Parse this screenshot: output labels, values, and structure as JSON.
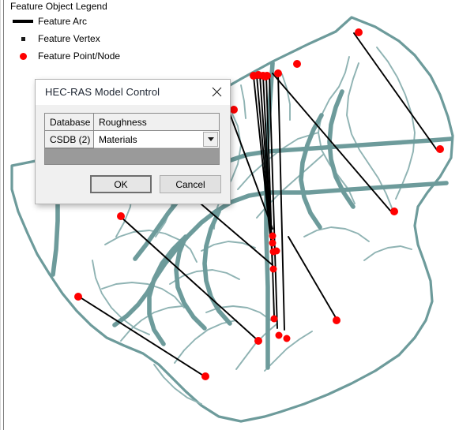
{
  "legend": {
    "title": "Feature Object Legend",
    "items": [
      {
        "symbol": "line-symbol",
        "label": "Feature Arc"
      },
      {
        "symbol": "square-symbol",
        "label": "Feature Vertex"
      },
      {
        "symbol": "circle-symbol",
        "label": "Feature Point/Node"
      }
    ]
  },
  "dialog": {
    "title": "HEC-RAS Model Control",
    "close_label": "×",
    "grid": {
      "headers": [
        "Database",
        "Roughness"
      ],
      "rows": [
        {
          "database": "CSDB (2)",
          "roughness": "Materials"
        }
      ],
      "roughness_options": [
        "Materials"
      ]
    },
    "buttons": {
      "ok": "OK",
      "cancel": "Cancel"
    }
  },
  "map": {
    "colors": {
      "terrain": "#6d9b9b",
      "terrain_light": "#8fb3b3",
      "arc": "#000000",
      "node": "#ff0000",
      "background": "#ffffff"
    },
    "node_count": 24,
    "arc_count": 12
  }
}
